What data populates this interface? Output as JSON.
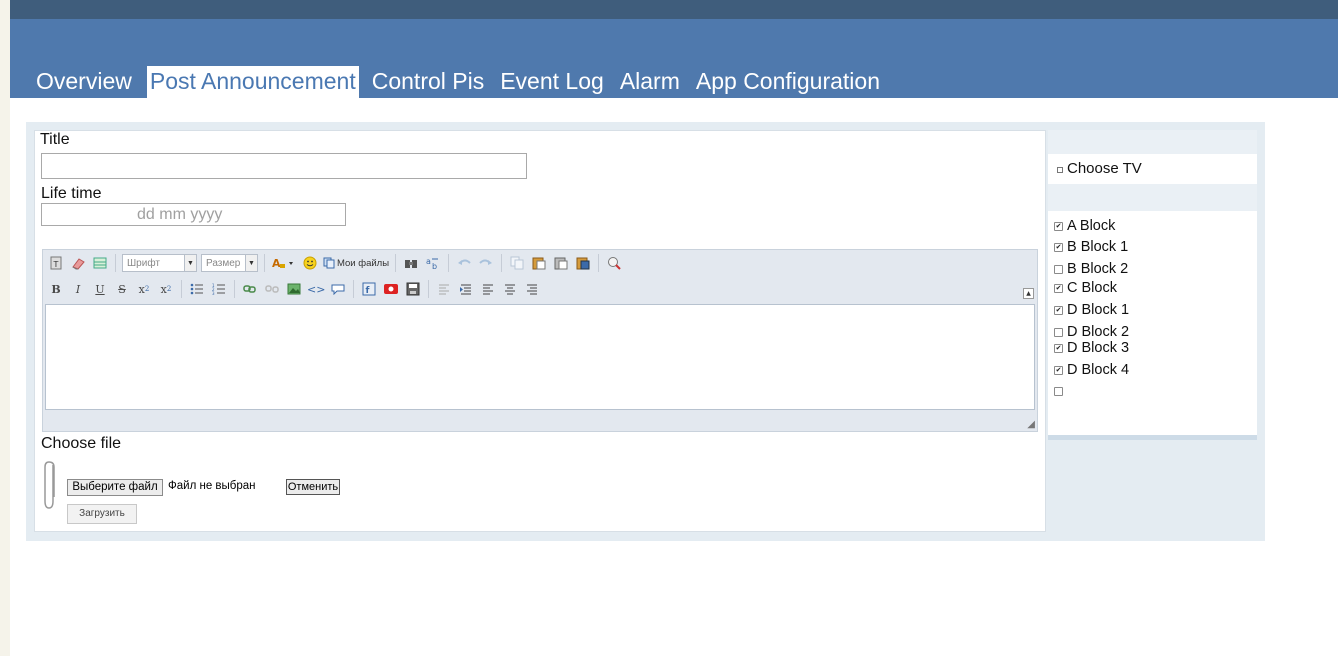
{
  "nav": {
    "tabs": [
      {
        "label": "Overview"
      },
      {
        "label": "Post Announcement",
        "active": true
      },
      {
        "label": "Control Pis"
      },
      {
        "label": "Event Log"
      },
      {
        "label": "Alarm"
      },
      {
        "label": "App Configuration"
      }
    ]
  },
  "form": {
    "title_label": "Title",
    "title_value": "",
    "lifetime_label": "Life time",
    "lifetime_placeholder": "dd mm yyyy",
    "editor": {
      "font_select": "Шрифт",
      "size_select": "Размер",
      "my_files_label": "Мои файлы",
      "content": ""
    },
    "choose_file_label": "Choose file",
    "file_button_label": "Выберите файл",
    "file_status": "Файл не выбран",
    "cancel_label": "Отменить",
    "upload_label": "Загрузить"
  },
  "sidebar": {
    "choose_tv_label": "Choose TV",
    "blocks": [
      {
        "name": "A Block",
        "checked": true
      },
      {
        "name": "B Block 1",
        "checked": true
      },
      {
        "name": "B Block 2",
        "checked": false
      },
      {
        "name": "C Block",
        "checked": true
      },
      {
        "name": "D Block 1",
        "checked": true
      },
      {
        "name": "D Block 2",
        "checked": false
      },
      {
        "name": "D Block 3",
        "checked": true
      },
      {
        "name": "D Block 4",
        "checked": true
      },
      {
        "name": "",
        "checked": false
      }
    ]
  },
  "colors": {
    "header": "#4f79ad",
    "topbar": "#3f5d7c",
    "active_tab_text": "#4a78b2",
    "panel_bg": "#e4ecf2"
  }
}
